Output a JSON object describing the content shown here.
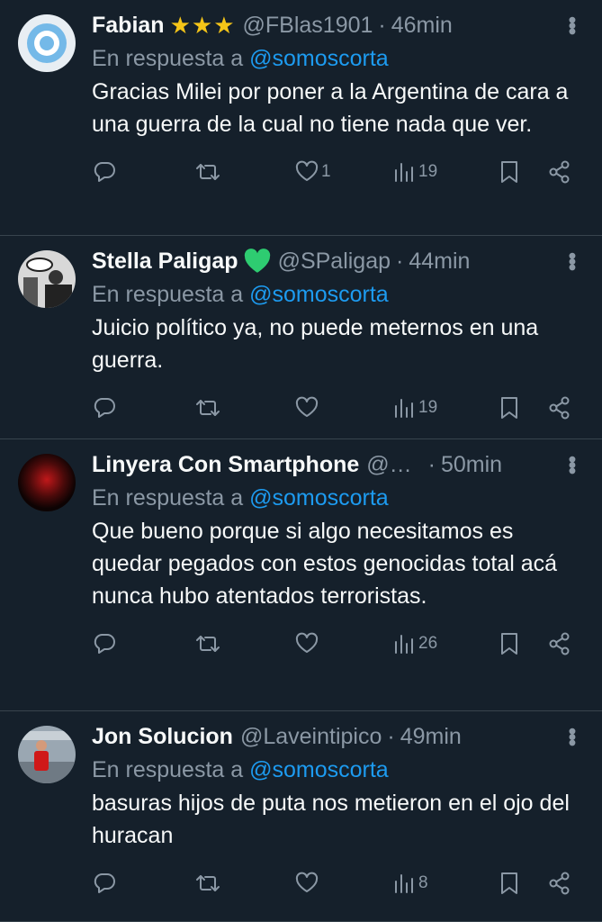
{
  "replies": [
    {
      "name": "Fabian",
      "badge": "★★★",
      "handle": "@FBlas1901",
      "time": "46min",
      "replying_prefix": "En respuesta a",
      "mention": "@somoscorta",
      "text": "Gracias Milei por poner a la Argentina de cara a una guerra de la cual no tiene nada que ver.",
      "likes": "1",
      "views": "19"
    },
    {
      "name": "Stella Paligap",
      "badge": "💚",
      "handle": "@SPaligap",
      "time": "44min",
      "replying_prefix": "En respuesta a",
      "mention": "@somoscorta",
      "text": "Juicio político ya, no puede meternos en una guerra.",
      "likes": "",
      "views": "19"
    },
    {
      "name": "Linyera Con Smartphone",
      "badge": "",
      "handle": "@…",
      "time": "50min",
      "replying_prefix": "En respuesta a",
      "mention": "@somoscorta",
      "text": "Que bueno porque si algo necesitamos es quedar pegados con estos genocidas total acá nunca hubo atentados terroristas.",
      "likes": "",
      "views": "26"
    },
    {
      "name": "Jon Solucion",
      "badge": "",
      "handle": "@Laveintipico",
      "time": "49min",
      "replying_prefix": "En respuesta a",
      "mention": "@somoscorta",
      "text": "basuras hijos de puta nos metieron en el ojo del huracan",
      "likes": "",
      "views": "8"
    }
  ],
  "colors": {
    "background": "#15202b",
    "secondary": "#8b98a5",
    "link": "#1d9bf0",
    "divider": "#38444d"
  }
}
